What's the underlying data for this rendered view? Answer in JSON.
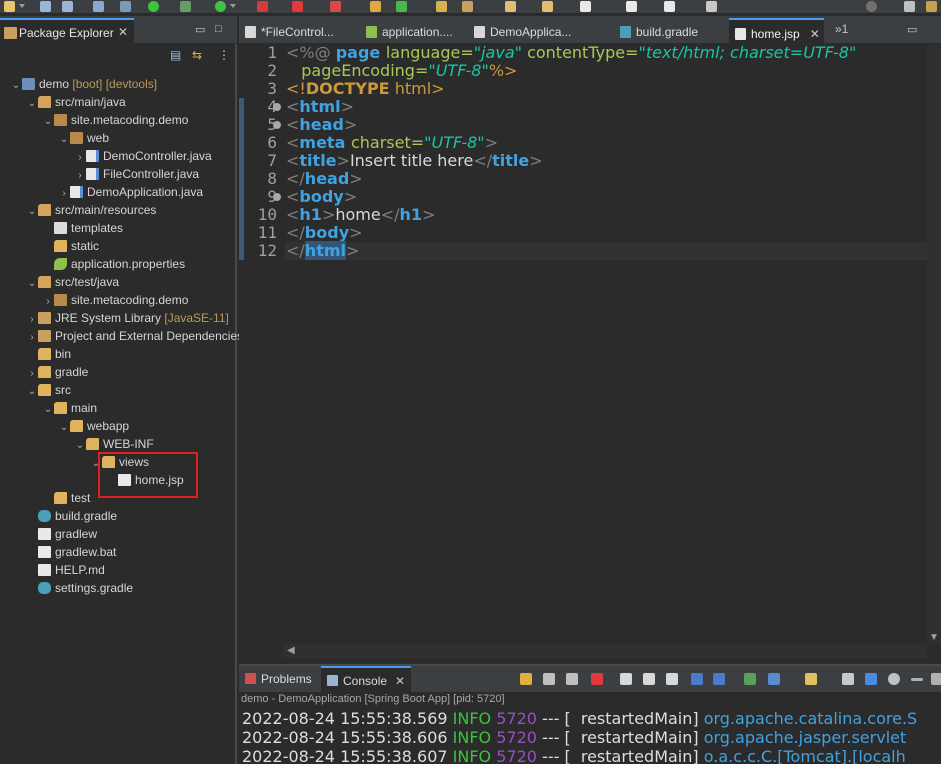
{
  "colors": {
    "accent": "#4a9ef0",
    "highlight_box": "#e02020",
    "tag": "#3fa3e0",
    "attribute": "#a7c957",
    "string_value": "#17c6a3",
    "log_info": "#3cc43c"
  },
  "explorer": {
    "title": "Package Explorer",
    "close": "✕",
    "minimize": "▭",
    "maximize": "□",
    "tools": [
      "collapse-all-icon",
      "link-with-editor-icon",
      "view-menu-icon"
    ],
    "tree": [
      {
        "label": "demo",
        "deco": "[boot] [devtools]",
        "depth": 0,
        "twisty": "v",
        "icon": "project"
      },
      {
        "label": "src/main/java",
        "deco": "",
        "depth": 1,
        "twisty": "v",
        "icon": "srcfolder"
      },
      {
        "label": "site.metacoding.demo",
        "deco": "",
        "depth": 2,
        "twisty": "v",
        "icon": "package"
      },
      {
        "label": "web",
        "deco": "",
        "depth": 3,
        "twisty": "v",
        "icon": "package"
      },
      {
        "label": "DemoController.java",
        "deco": "",
        "depth": 4,
        "twisty": ">",
        "icon": "java"
      },
      {
        "label": "FileController.java",
        "deco": "",
        "depth": 4,
        "twisty": ">",
        "icon": "java"
      },
      {
        "label": "DemoApplication.java",
        "deco": "",
        "depth": 3,
        "twisty": ">",
        "icon": "java"
      },
      {
        "label": "src/main/resources",
        "deco": "",
        "depth": 1,
        "twisty": "v",
        "icon": "srcfolder"
      },
      {
        "label": "templates",
        "deco": "",
        "depth": 2,
        "twisty": "",
        "icon": "templates"
      },
      {
        "label": "static",
        "deco": "",
        "depth": 2,
        "twisty": "",
        "icon": "folder"
      },
      {
        "label": "application.properties",
        "deco": "",
        "depth": 2,
        "twisty": "",
        "icon": "leaf"
      },
      {
        "label": "src/test/java",
        "deco": "",
        "depth": 1,
        "twisty": "v",
        "icon": "srcfolder"
      },
      {
        "label": "site.metacoding.demo",
        "deco": "",
        "depth": 2,
        "twisty": ">",
        "icon": "package"
      },
      {
        "label": "JRE System Library",
        "deco": "[JavaSE-11]",
        "depth": 1,
        "twisty": ">",
        "icon": "lib"
      },
      {
        "label": "Project and External Dependencies",
        "deco": "",
        "depth": 1,
        "twisty": ">",
        "icon": "lib"
      },
      {
        "label": "bin",
        "deco": "",
        "depth": 1,
        "twisty": "",
        "icon": "folder"
      },
      {
        "label": "gradle",
        "deco": "",
        "depth": 1,
        "twisty": ">",
        "icon": "folder"
      },
      {
        "label": "src",
        "deco": "",
        "depth": 1,
        "twisty": "v",
        "icon": "folder"
      },
      {
        "label": "main",
        "deco": "",
        "depth": 2,
        "twisty": "v",
        "icon": "folder"
      },
      {
        "label": "webapp",
        "deco": "",
        "depth": 3,
        "twisty": "v",
        "icon": "folder"
      },
      {
        "label": "WEB-INF",
        "deco": "",
        "depth": 4,
        "twisty": "v",
        "icon": "folder"
      },
      {
        "label": "views",
        "deco": "",
        "depth": 5,
        "twisty": "v",
        "icon": "folder"
      },
      {
        "label": "home.jsp",
        "deco": "",
        "depth": 6,
        "twisty": "",
        "icon": "file"
      },
      {
        "label": "test",
        "deco": "",
        "depth": 2,
        "twisty": "",
        "icon": "folder"
      },
      {
        "label": "build.gradle",
        "deco": "",
        "depth": 1,
        "twisty": "",
        "icon": "gradle"
      },
      {
        "label": "gradlew",
        "deco": "",
        "depth": 1,
        "twisty": "",
        "icon": "file"
      },
      {
        "label": "gradlew.bat",
        "deco": "",
        "depth": 1,
        "twisty": "",
        "icon": "file"
      },
      {
        "label": "HELP.md",
        "deco": "",
        "depth": 1,
        "twisty": "",
        "icon": "file"
      },
      {
        "label": "settings.gradle",
        "deco": "",
        "depth": 1,
        "twisty": "",
        "icon": "gradle"
      }
    ]
  },
  "editor": {
    "tabs": [
      {
        "label": "*FileControl...",
        "icon": "java-file-icon",
        "active": false
      },
      {
        "label": "application....",
        "icon": "properties-file-icon",
        "active": false
      },
      {
        "label": "DemoApplica...",
        "icon": "java-file-icon",
        "active": false
      },
      {
        "label": "build.gradle",
        "icon": "gradle-file-icon",
        "active": false
      },
      {
        "label": "home.jsp",
        "icon": "jsp-file-icon",
        "active": true
      }
    ],
    "overflow": "»1",
    "close": "✕",
    "minimize": "▭",
    "lines": [
      {
        "n": "1",
        "fold": false,
        "segments": [
          [
            "bracket",
            "<%@ "
          ],
          [
            "tag",
            "page "
          ],
          [
            "attr",
            "language="
          ],
          [
            "val",
            "\"java\""
          ],
          [
            "attr",
            " contentType="
          ],
          [
            "val",
            "\"text/html; charset=UTF-8\""
          ]
        ]
      },
      {
        "n": "2",
        "fold": false,
        "segments": [
          [
            "attr",
            "   pageEncoding="
          ],
          [
            "val",
            "\"UTF-8\""
          ],
          [
            "dir",
            "%>"
          ]
        ]
      },
      {
        "n": "3",
        "fold": false,
        "segments": [
          [
            "dir",
            "<!"
          ],
          [
            "doctype",
            "DOCTYPE"
          ],
          [
            "dir",
            " html>"
          ]
        ]
      },
      {
        "n": "4",
        "fold": true,
        "segments": [
          [
            "bracket",
            "<"
          ],
          [
            "tag",
            "html"
          ],
          [
            "bracket",
            ">"
          ]
        ]
      },
      {
        "n": "5",
        "fold": true,
        "segments": [
          [
            "bracket",
            "<"
          ],
          [
            "tag",
            "head"
          ],
          [
            "bracket",
            ">"
          ]
        ]
      },
      {
        "n": "6",
        "fold": false,
        "segments": [
          [
            "bracket",
            "<"
          ],
          [
            "tag",
            "meta "
          ],
          [
            "attr",
            "charset="
          ],
          [
            "val",
            "\"UTF-8\""
          ],
          [
            "bracket",
            ">"
          ]
        ]
      },
      {
        "n": "7",
        "fold": false,
        "segments": [
          [
            "bracket",
            "<"
          ],
          [
            "tag",
            "title"
          ],
          [
            "bracket",
            ">"
          ],
          [
            "text",
            "Insert title here"
          ],
          [
            "bracket",
            "</"
          ],
          [
            "tag",
            "title"
          ],
          [
            "bracket",
            ">"
          ]
        ]
      },
      {
        "n": "8",
        "fold": false,
        "segments": [
          [
            "bracket",
            "</"
          ],
          [
            "tag",
            "head"
          ],
          [
            "bracket",
            ">"
          ]
        ]
      },
      {
        "n": "9",
        "fold": true,
        "segments": [
          [
            "bracket",
            "<"
          ],
          [
            "tag",
            "body"
          ],
          [
            "bracket",
            ">"
          ]
        ]
      },
      {
        "n": "10",
        "fold": false,
        "segments": [
          [
            "bracket",
            "<"
          ],
          [
            "tag",
            "h1"
          ],
          [
            "bracket",
            ">"
          ],
          [
            "text",
            "home"
          ],
          [
            "bracket",
            "</"
          ],
          [
            "tag",
            "h1"
          ],
          [
            "bracket",
            ">"
          ]
        ]
      },
      {
        "n": "11",
        "fold": false,
        "segments": [
          [
            "bracket",
            "</"
          ],
          [
            "tag",
            "body"
          ],
          [
            "bracket",
            ">"
          ]
        ]
      },
      {
        "n": "12",
        "fold": false,
        "segments": [
          [
            "bracket",
            "</"
          ],
          [
            "seltag",
            "html"
          ],
          [
            "bracket",
            ">"
          ]
        ]
      }
    ]
  },
  "console": {
    "tabs": [
      {
        "label": "Problems",
        "icon": "problems-icon",
        "active": false
      },
      {
        "label": "Console",
        "icon": "console-icon",
        "active": true
      }
    ],
    "close": "✕",
    "description": "demo - DemoApplication [Spring Boot App]  [pid: 5720]",
    "logs": [
      {
        "time": "2022-08-24 15:55:38.569",
        "level": "INFO",
        "pid": "5720",
        "sep": " --- [  restartedMain] ",
        "logger": "org.apache.catalina.core.S"
      },
      {
        "time": "2022-08-24 15:55:38.606",
        "level": "INFO",
        "pid": "5720",
        "sep": " --- [  restartedMain] ",
        "logger": "org.apache.jasper.servlet"
      },
      {
        "time": "2022-08-24 15:55:38.607",
        "level": "INFO",
        "pid": "5720",
        "sep": " --- [  restartedMain] ",
        "logger": "o.a.c.c.C.[Tomcat].[localh"
      }
    ]
  }
}
